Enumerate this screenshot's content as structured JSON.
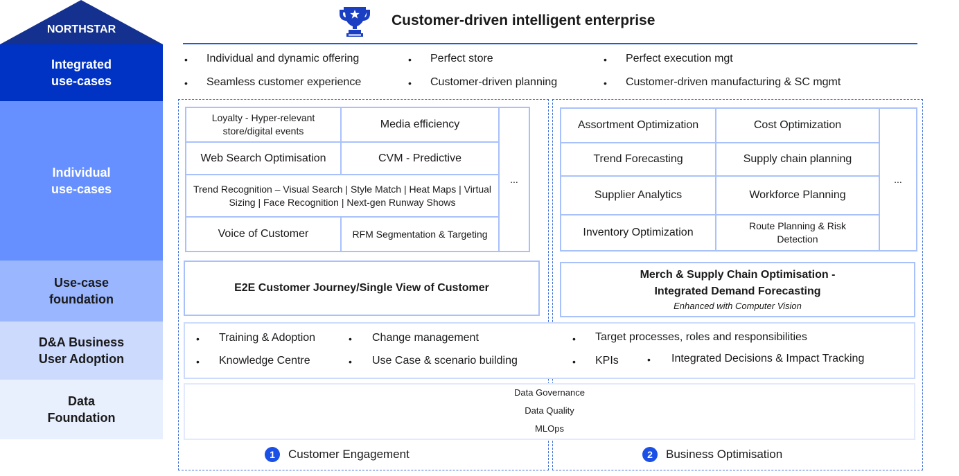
{
  "northstar": {
    "label": "NORTHSTAR",
    "title": "Customer-driven intelligent enterprise",
    "icon": "trophy-icon"
  },
  "layers": [
    {
      "label_line1": "Integrated",
      "label_line2": "use-cases"
    },
    {
      "label_line1": "Individual",
      "label_line2": "use-cases"
    },
    {
      "label_line1": "Use-case",
      "label_line2": "foundation"
    },
    {
      "label_line1": "D&A Business",
      "label_line2": "User Adoption"
    },
    {
      "label_line1": "Data",
      "label_line2": "Foundation"
    }
  ],
  "integrated_use_cases": [
    "Individual and dynamic offering",
    "Perfect store",
    "Perfect execution mgt",
    "Seamless customer experience",
    "Customer-driven planning",
    "Customer-driven manufacturing & SC mgmt"
  ],
  "customer_engagement": {
    "number": "1",
    "name": "Customer Engagement",
    "use_cases": [
      "Loyalty - Hyper-relevant store/digital events",
      "Media efficiency",
      "Web Search Optimisation",
      "CVM - Predictive",
      "Trend Recognition – Visual Search | Style Match | Heat Maps | Virtual Sizing | Face Recognition | Next-gen Runway Shows",
      "Voice of Customer",
      "RFM Segmentation & Targeting"
    ],
    "more": "...",
    "foundation": "E2E Customer Journey/Single View of Customer"
  },
  "business_optimisation": {
    "number": "2",
    "name": "Business Optimisation",
    "use_cases": [
      "Assortment Optimization",
      "Cost Optimization",
      "Trend Forecasting",
      "Supply chain planning",
      "Supplier Analytics",
      "Workforce Planning",
      "Inventory Optimization",
      "Route Planning & Risk Detection"
    ],
    "more": "...",
    "foundation_line1": "Merch & Supply Chain Optimisation -",
    "foundation_line2": "Integrated Demand Forecasting",
    "foundation_sub": "Enhanced with Computer Vision"
  },
  "adoption": [
    "Training & Adoption",
    "Change management",
    "Target processes, roles and responsibilities",
    "Knowledge Centre",
    "Use Case & scenario building",
    "KPIs",
    "Integrated Decisions & Impact Tracking"
  ],
  "data_foundation": [
    "Data Governance",
    "Data Quality",
    "MLOps"
  ],
  "bullet": "•",
  "colors": {
    "northstar_roof": "#14318f",
    "integrated": "#0033c4",
    "individual": "#6690ff",
    "foundation": "#99b6ff",
    "adoption": "#ccdafd",
    "data": "#e8effd",
    "accent": "#1a50e6",
    "cell_border": "#a9c1fb"
  }
}
